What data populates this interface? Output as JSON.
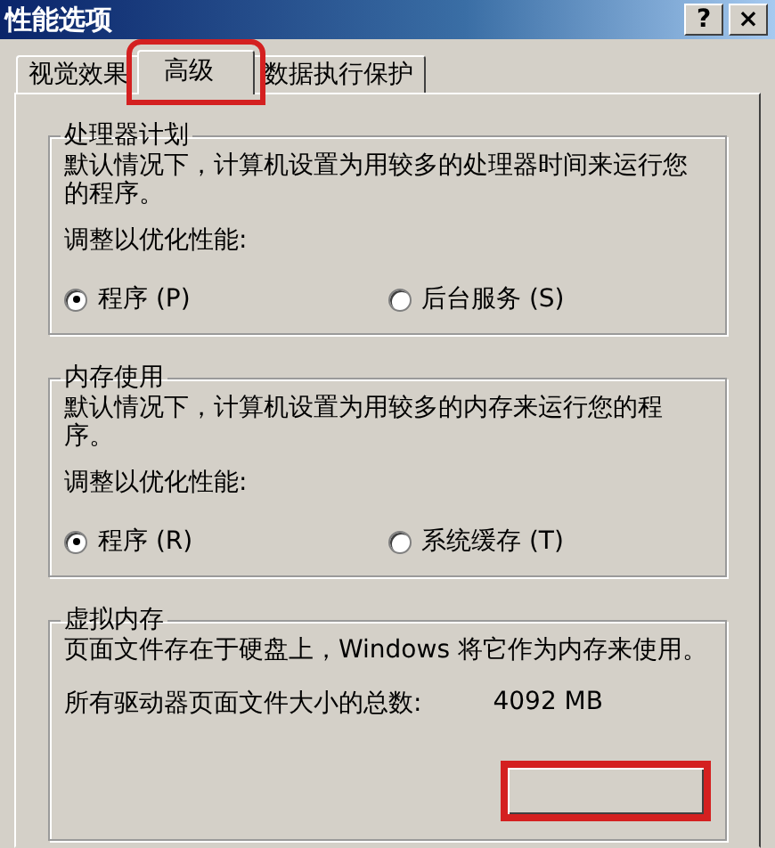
{
  "window": {
    "title": "性能选项",
    "buttons": [
      "?",
      "×"
    ]
  },
  "tabs": [
    {
      "label": "视觉效果",
      "selected": false,
      "highlighted": false
    },
    {
      "label": "高级",
      "selected": true,
      "highlighted": true
    },
    {
      "label": "数据执行保护",
      "selected": false,
      "highlighted": false
    }
  ],
  "groups": [
    {
      "kind": "radio_group",
      "title": "处理器计划",
      "description": "默认情况下，计算机设置为用较多的处理器时间来运行您的程序。",
      "adjust_label": "调整以优化性能:",
      "options": [
        {
          "label": "程序 (P)",
          "selected": true
        },
        {
          "label": "后台服务 (S)",
          "selected": false
        }
      ]
    },
    {
      "kind": "radio_group",
      "title": "内存使用",
      "description": "默认情况下，计算机设置为用较多的内存来运行您的程序。",
      "adjust_label": "调整以优化性能:",
      "options": [
        {
          "label": "程序 (R)",
          "selected": true
        },
        {
          "label": "系统缓存 (T)",
          "selected": false
        }
      ]
    },
    {
      "kind": "virtual_memory",
      "title": "虚拟内存",
      "description": "页面文件存在于硬盘上，Windows 将它作为内存来使用。",
      "total_label": "所有驱动器页面文件大小的总数:",
      "total_value": "4092 MB",
      "button": {
        "highlighted": true
      }
    }
  ]
}
